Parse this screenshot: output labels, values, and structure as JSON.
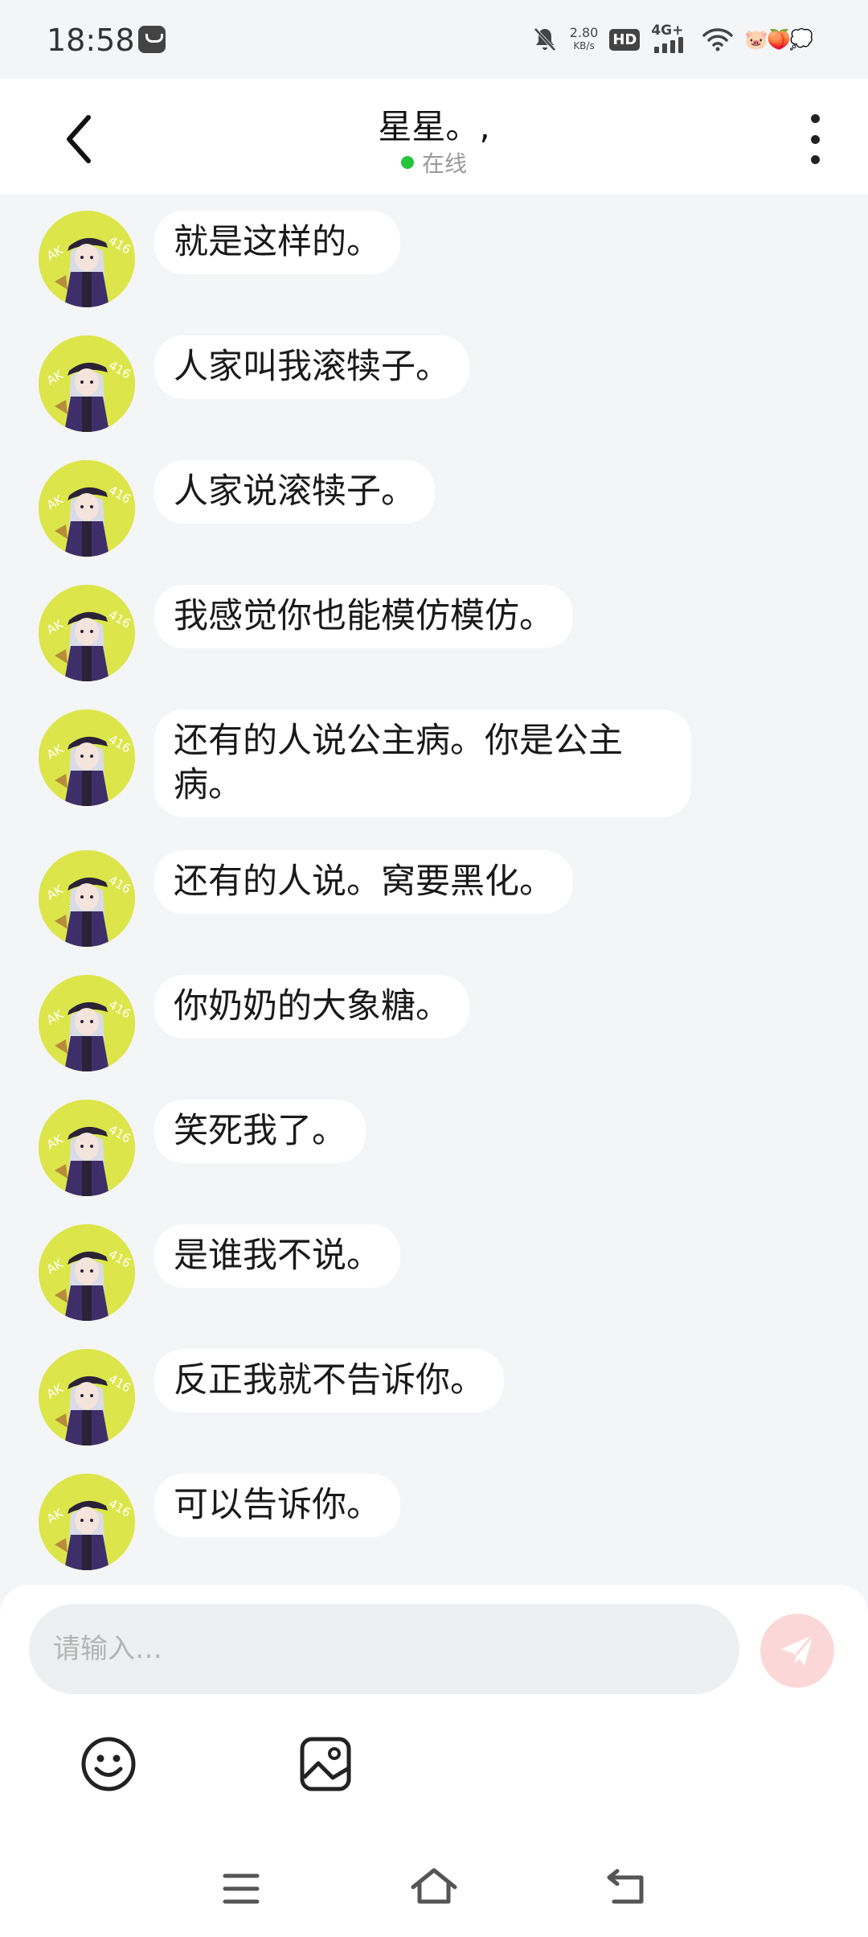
{
  "status_bar": {
    "time": "18:58",
    "speed_value": "2.80",
    "speed_unit": "KB/s",
    "hd_label": "HD",
    "network_label": "4G+",
    "emoji_decor": "🐷🍑💭"
  },
  "header": {
    "title": "星星。,",
    "status": "在线",
    "online_color": "#25c53a"
  },
  "messages": [
    {
      "text": "就是这样的。"
    },
    {
      "text": "人家叫我滚犊子。"
    },
    {
      "text": "人家说滚犊子。"
    },
    {
      "text": "我感觉你也能模仿模仿。"
    },
    {
      "text": "还有的人说公主病。你是公主病。"
    },
    {
      "text": "还有的人说。窝要黑化。"
    },
    {
      "text": "你奶奶的大象糖。"
    },
    {
      "text": "笑死我了。"
    },
    {
      "text": "是谁我不说。"
    },
    {
      "text": "反正我就不告诉你。"
    },
    {
      "text": "可以告诉你。"
    }
  ],
  "composer": {
    "placeholder": "请输入…",
    "send_color": "#fbd8d7"
  },
  "icons": {
    "back": "chevron-left-icon",
    "more": "more-vertical-icon",
    "send": "paper-plane-icon",
    "emoji": "smiley-icon",
    "image": "image-icon",
    "nav_menu": "menu-icon",
    "nav_home": "home-icon",
    "nav_back": "back-arrow-icon"
  },
  "colors": {
    "background": "#f4f5f7",
    "bubble": "#ffffff",
    "avatar_bg": "#dce64a"
  }
}
